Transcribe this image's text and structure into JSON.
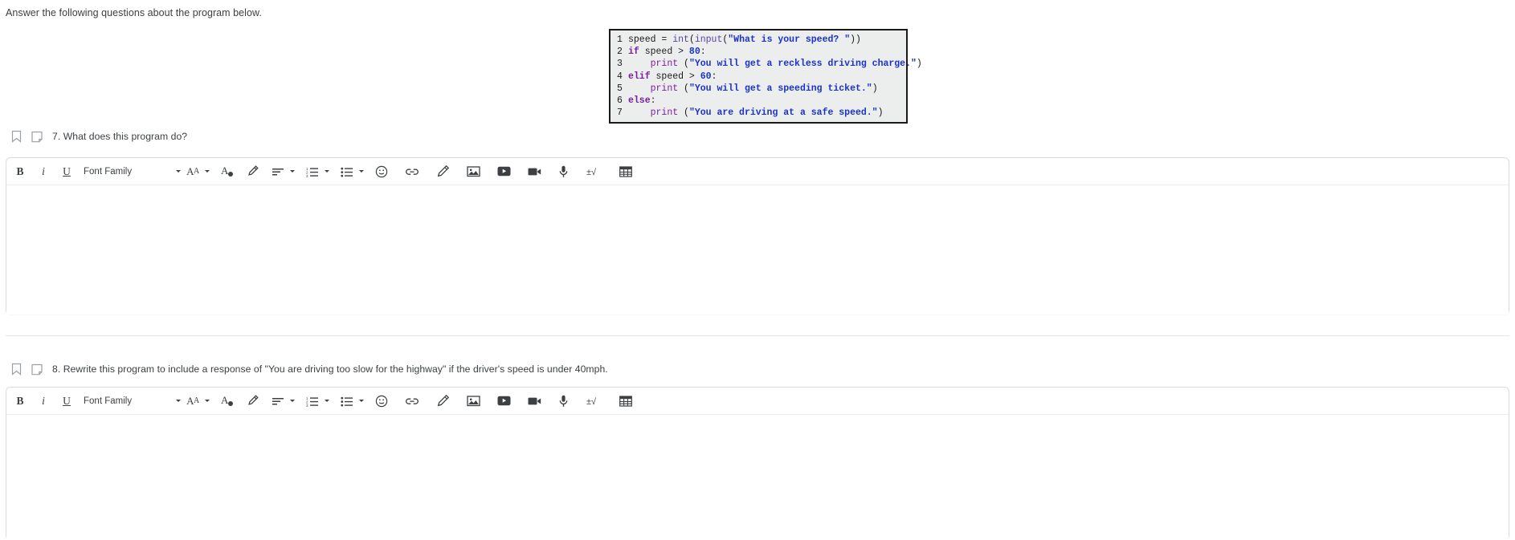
{
  "intro": {
    "text": "Answer the following questions about the program below."
  },
  "code_block": {
    "language": "python",
    "lines": [
      {
        "num": "1",
        "raw": "speed = int(input(\"What is your speed? \"))"
      },
      {
        "num": "2",
        "raw": "if speed > 80:"
      },
      {
        "num": "3",
        "raw": "    print (\"You will get a reckless driving charge.\")"
      },
      {
        "num": "4",
        "raw": "elif speed > 60:"
      },
      {
        "num": "5",
        "raw": "    print (\"You will get a speeding ticket.\")"
      },
      {
        "num": "6",
        "raw": "else:"
      },
      {
        "num": "7",
        "raw": "    print (\"You are driving at a safe speed.\")"
      }
    ],
    "colors": {
      "border": "#1a1a1a",
      "background": "#eceded",
      "keyword": "#7a1fa2",
      "string": "#1a33cc",
      "text": "#1b1b1b"
    }
  },
  "questions": [
    {
      "bookmark_icon": "bookmark-icon",
      "note_icon": "sticky-note-icon",
      "text": "7. What does this program do?"
    },
    {
      "bookmark_icon": "bookmark-icon",
      "note_icon": "sticky-note-icon",
      "text": "8. Rewrite this program to include a response of \"You are driving too slow for the highway\" if the driver's speed is under 40mph."
    }
  ],
  "toolbar": {
    "bold_label": "B",
    "italic_label": "i",
    "underline_label": "U",
    "font_family_label": "Font Family",
    "font_size_label": "AA",
    "items": [
      "bold",
      "italic",
      "underline",
      "font-family",
      "font-family-caret",
      "font-size-caret-left",
      "font-size",
      "font-size-caret-right",
      "text-color",
      "highlight-color",
      "align",
      "align-caret",
      "numbered-list",
      "numbered-list-caret",
      "bulleted-list",
      "bulleted-list-caret",
      "emoji",
      "link",
      "draw",
      "image",
      "youtube",
      "video",
      "audio",
      "math",
      "table"
    ]
  },
  "editors": [
    {
      "name": "answer-editor-q7",
      "content": ""
    },
    {
      "name": "answer-editor-q8",
      "content": ""
    }
  ]
}
